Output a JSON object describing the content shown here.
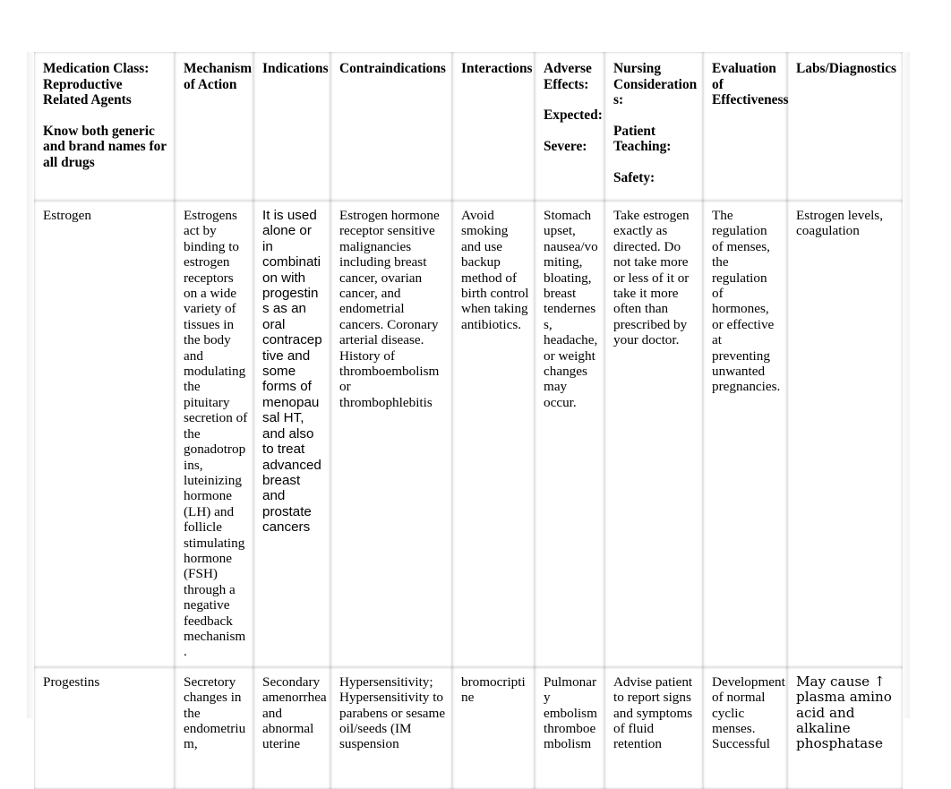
{
  "document": {
    "type": "medication-table",
    "columns": [
      {
        "key": "medication_class",
        "header_lines": [
          "Medication Class: Reproductive Related Agents"
        ],
        "header_sub": [
          "Know both generic and brand names for all drugs"
        ]
      },
      {
        "key": "mechanism_of_action",
        "header_lines": [
          "Mechanism of Action"
        ],
        "header_sub": []
      },
      {
        "key": "indications",
        "header_lines": [
          "Indications"
        ],
        "header_sub": []
      },
      {
        "key": "contraindications",
        "header_lines": [
          "Contraindications"
        ],
        "header_sub": []
      },
      {
        "key": "interactions",
        "header_lines": [
          "Interactions"
        ],
        "header_sub": []
      },
      {
        "key": "adverse_effects",
        "header_lines": [
          "Adverse Effects:"
        ],
        "header_sub": [
          "Expected:",
          "Severe:"
        ]
      },
      {
        "key": "nursing_considerations",
        "header_lines": [
          "Nursing Considerations:"
        ],
        "header_sub": [
          "Patient Teaching:",
          "Safety:"
        ]
      },
      {
        "key": "evaluation_of_effectiveness",
        "header_lines": [
          "Evaluation of Effectiveness"
        ],
        "header_sub": []
      },
      {
        "key": "labs_diagnostics",
        "header_lines": [
          "Labs/Diagnostics"
        ],
        "header_sub": []
      }
    ],
    "headers": {
      "medication_class_title": "Medication Class: Reproductive Related Agents",
      "medication_class_note": "Know both generic and brand names for all drugs",
      "mechanism_of_action": "Mechanism of Action",
      "indications": "Indications",
      "contraindications": "Contraindications",
      "interactions": "Interactions",
      "adverse_effects": "Adverse Effects:",
      "adverse_expected": "Expected:",
      "adverse_severe": "Severe:",
      "nursing_considerations": "Nursing Considerations:",
      "nursing_patient_teaching": "Patient Teaching:",
      "nursing_safety": "Safety:",
      "evaluation_of_effectiveness": "Evaluation of Effectiveness",
      "labs_diagnostics": "Labs/Diagnostics"
    },
    "rows": [
      {
        "medication_class": "Estrogen",
        "mechanism_of_action": "Estrogens act by binding to estrogen receptors on a wide variety of tissues in the body and modulating the pituitary secretion of the gonadotropins, luteinizing hormone (LH) and follicle stimulating hormone (FSH) through a negative feedback mechanism.",
        "indications": "It is used alone or in combination with progestins as an oral contraceptive and some forms of menopausal HT, and also to treat advanced breast and prostate cancers",
        "contraindications": "Estrogen hormone receptor sensitive malignancies including breast cancer, ovarian cancer, and endometrial cancers. Coronary arterial disease. History of thromboembolism or thrombophlebitis",
        "interactions": "Avoid smoking and use backup method of birth control when taking antibiotics.",
        "adverse_effects": "Stomach upset, nausea/vomiting, bloating, breast tenderness, headache, or weight changes may occur.",
        "nursing_considerations": "Take estrogen exactly as directed. Do not take more or less of it or take it more often than prescribed by your doctor.",
        "evaluation_of_effectiveness": "The regulation of menses, the regulation of hormones, or effective at preventing unwanted pregnancies.",
        "labs_diagnostics": "Estrogen levels, coagulation"
      },
      {
        "medication_class": "Progestins",
        "mechanism_of_action": "Secretory changes in the endometrium,",
        "indications": "Secondary amenorrhea and abnormal uterine",
        "contraindications": "Hypersensitivity; Hypersensitivity to parabens or sesame oil/seeds (IM suspension",
        "interactions": "bromocriptine",
        "adverse_effects": "Pulmonary embolism thromboembolism",
        "nursing_considerations": "Advise patient to report signs and symptoms of fluid retention",
        "evaluation_of_effectiveness": "Development of normal cyclic menses. Successful",
        "labs_diagnostics": "May cause ↑ plasma amino acid and alkaline phosphatase"
      }
    ]
  }
}
